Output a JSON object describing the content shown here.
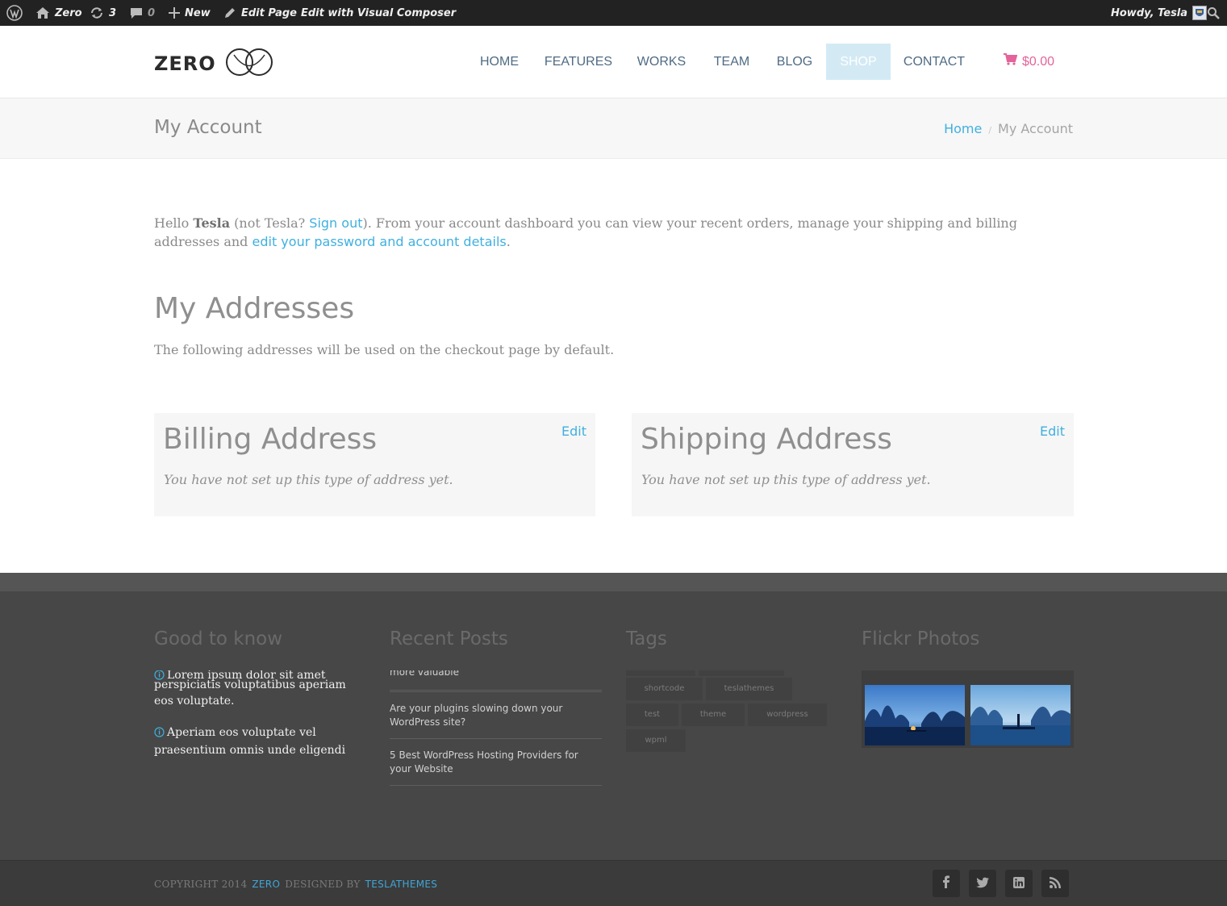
{
  "admin_bar": {
    "site_name": "Zero",
    "updates_count": "3",
    "comments_count": "0",
    "new_label": "New",
    "edit_page_label": "Edit Page",
    "visual_composer_label": "Edit with Visual Composer",
    "howdy_label": "Howdy, Tesla"
  },
  "header": {
    "logo_text": "ZERO",
    "nav": [
      "HOME",
      "FEATURES",
      "WORKS",
      "TEAM",
      "BLOG",
      "SHOP",
      "CONTACT"
    ],
    "active_nav": "SHOP",
    "cart_total": "$0.00"
  },
  "title_bar": {
    "title": "My Account",
    "breadcrumb_home": "Home",
    "breadcrumb_sep": "/",
    "breadcrumb_current": "My Account"
  },
  "intro": {
    "hello": "Hello ",
    "user": "Tesla",
    "not_user_pre": " (not Tesla? ",
    "sign_out": "Sign out",
    "middle": "). From your account dashboard you can view your recent orders, manage your shipping and billing addresses and ",
    "edit_link": "edit your password and account details",
    "end": "."
  },
  "addresses": {
    "heading": "My Addresses",
    "description": "The following addresses will be used on the checkout page by default.",
    "billing": {
      "title": "Billing Address",
      "edit": "Edit",
      "empty": "You have not set up this type of address yet."
    },
    "shipping": {
      "title": "Shipping Address",
      "edit": "Edit",
      "empty": "You have not set up this type of address yet."
    }
  },
  "footer": {
    "good_to_know": {
      "title": "Good to know",
      "items": [
        "Lorem ipsum dolor sit amet",
        "perspiciatis voluptatibus aperiam eos voluptate.",
        "Aperiam eos voluptate vel praesentium omnis unde eligendi"
      ]
    },
    "recent_posts": {
      "title": "Recent Posts",
      "items": [
        "more valuable",
        "Are your plugins slowing down your WordPress site?",
        "5 Best WordPress Hosting Providers for your Website"
      ]
    },
    "tags": {
      "title": "Tags",
      "items": [
        "shortcode",
        "teslathemes",
        "test",
        "theme",
        "wordpress",
        "wpml"
      ]
    },
    "flickr": {
      "title": "Flickr Photos"
    }
  },
  "copyright": {
    "prefix": "COPYRIGHT 2014",
    "site": "ZERO",
    "designed_by": "DESIGNED BY",
    "designer": "TESLATHEMES"
  },
  "colors": {
    "accent": "#3fb0e0",
    "cart": "#e4639a",
    "active_nav_bg": "#d3eaf5",
    "admin_bar": "#222222",
    "footer_bg": "#474747"
  },
  "icons": {
    "admin_bar": [
      "wordpress-icon",
      "home-icon",
      "updates-icon",
      "comments-icon",
      "plus-icon",
      "pencil-icon",
      "avatar-icon",
      "search-icon"
    ],
    "social": [
      "facebook-icon",
      "twitter-icon",
      "linkedin-icon",
      "rss-icon"
    ]
  }
}
